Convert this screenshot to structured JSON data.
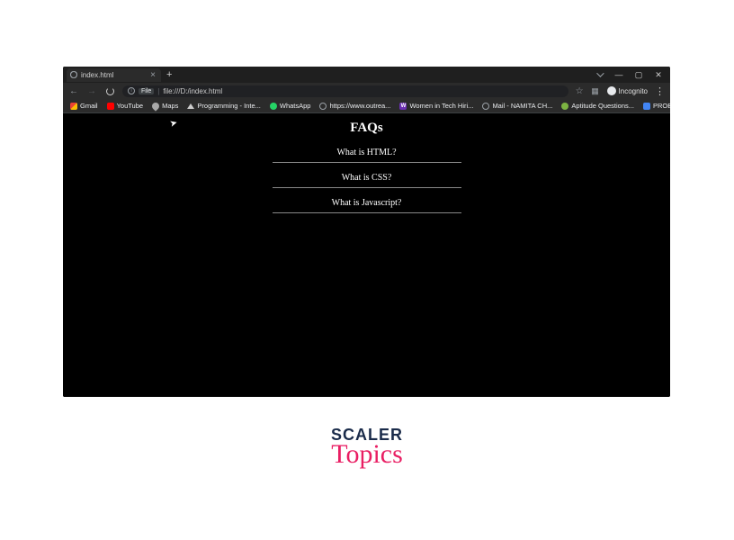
{
  "browser": {
    "tab_title": "index.html",
    "url_prefix_chip": "File",
    "url_text": "file:///D:/index.html",
    "incognito_label": "Incognito"
  },
  "bookmarks": [
    {
      "label": "Gmail",
      "icon": "bk-gmail"
    },
    {
      "label": "YouTube",
      "icon": "bk-youtube"
    },
    {
      "label": "Maps",
      "icon": "bk-maps"
    },
    {
      "label": "Programming - Inte...",
      "icon": "bk-hat"
    },
    {
      "label": "WhatsApp",
      "icon": "bk-whatsapp"
    },
    {
      "label": "https://www.outrea...",
      "icon": "bk-globe"
    },
    {
      "label": "Women in Tech Hiri...",
      "icon": "bk-w"
    },
    {
      "label": "Mail - NAMITA  CH...",
      "icon": "bk-mail"
    },
    {
      "label": "Aptitude Questions...",
      "icon": "bk-apt"
    },
    {
      "label": "PROBLEMS ON TRE...",
      "icon": "bk-docs"
    }
  ],
  "page": {
    "heading": "FAQs",
    "items": [
      "What is HTML?",
      "What is CSS?",
      "What is Javascript?"
    ]
  },
  "scaler": {
    "top": "SCALER",
    "bottom": "Topics"
  }
}
